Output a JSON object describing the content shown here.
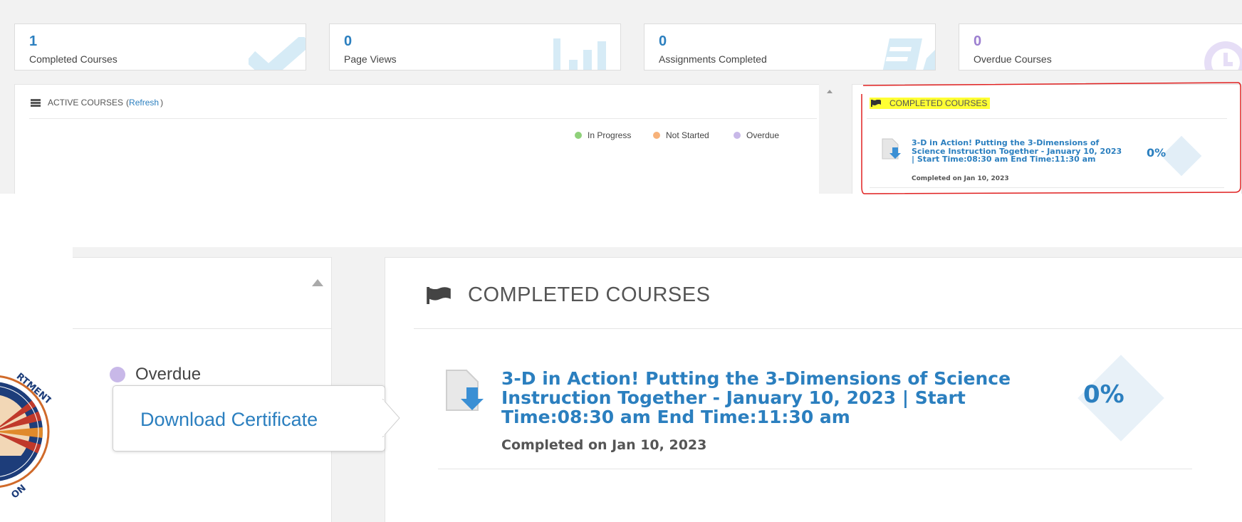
{
  "colors": {
    "accent_blue": "#2b7fbf",
    "in_progress": "#8fd17a",
    "not_started": "#f7b27a",
    "overdue": "#c8b8e8",
    "highlight": "#ffff33",
    "annotation": "#e02020"
  },
  "stats": [
    {
      "value": "1",
      "label": "Completed Courses",
      "value_color": "#2b7fbf",
      "icon": "checkmark-icon"
    },
    {
      "value": "0",
      "label": "Page Views",
      "value_color": "#2b7fbf",
      "icon": "bar-chart-icon"
    },
    {
      "value": "0",
      "label": "Assignments Completed",
      "value_color": "#2b7fbf",
      "icon": "assignment-icon"
    },
    {
      "value": "0",
      "label": "Overdue Courses",
      "value_color": "#9c7fd0",
      "icon": "clock-icon"
    }
  ],
  "active_courses": {
    "title": "ACTIVE COURSES",
    "refresh_open": "(",
    "refresh_label": "Refresh",
    "refresh_close": ")",
    "legend": [
      {
        "label": "In Progress"
      },
      {
        "label": "Not Started"
      },
      {
        "label": "Overdue"
      }
    ]
  },
  "completed_courses": {
    "title": "COMPLETED COURSES",
    "course": {
      "title": "3-D in Action! Putting the 3-Dimensions of Science Instruction Together - January 10, 2023 | Start Time:08:30 am End Time:11:30 am",
      "completed": "Completed on Jan 10, 2023",
      "progress": "0%"
    }
  },
  "zoom": {
    "legend_overdue": "Overdue",
    "tooltip": "Download Certificate",
    "title": "COMPLETED COURSES",
    "course_title": "3-D in Action! Putting the 3-Dimensions of Science Instruction Together - January 10, 2023 | Start Time:08:30 am End Time:11:30 am",
    "course_completed": "Completed on Jan 10, 2023",
    "course_progress": "0%"
  },
  "seal": {
    "text_top": "RTMENT",
    "text_bottom": "ON"
  }
}
